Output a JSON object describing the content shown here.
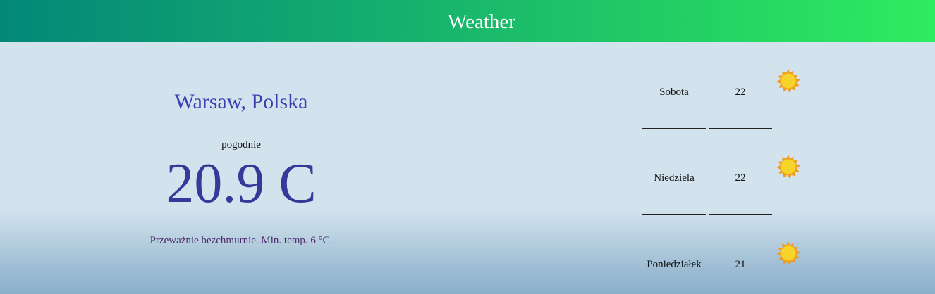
{
  "header": {
    "title": "Weather"
  },
  "current": {
    "city": "Warsaw, Polska",
    "condition": "pogodnie",
    "temperature": "20.9 C",
    "description": "Przeważnie bezchmurnie. Min. temp. 6 °C."
  },
  "forecast": [
    {
      "day": "Sobota",
      "temp": "22",
      "icon": "sun-icon"
    },
    {
      "day": "Niedziela",
      "temp": "22",
      "icon": "sun-icon"
    },
    {
      "day": "Poniedziałek",
      "temp": "21",
      "icon": "sun-icon"
    }
  ],
  "colors": {
    "header_gradient_start": "#038878",
    "header_gradient_end": "#2eec60",
    "city": "#3a3fb0",
    "temperature": "#35399a",
    "description": "#4c2a6b",
    "background": "#d3e3ee"
  }
}
